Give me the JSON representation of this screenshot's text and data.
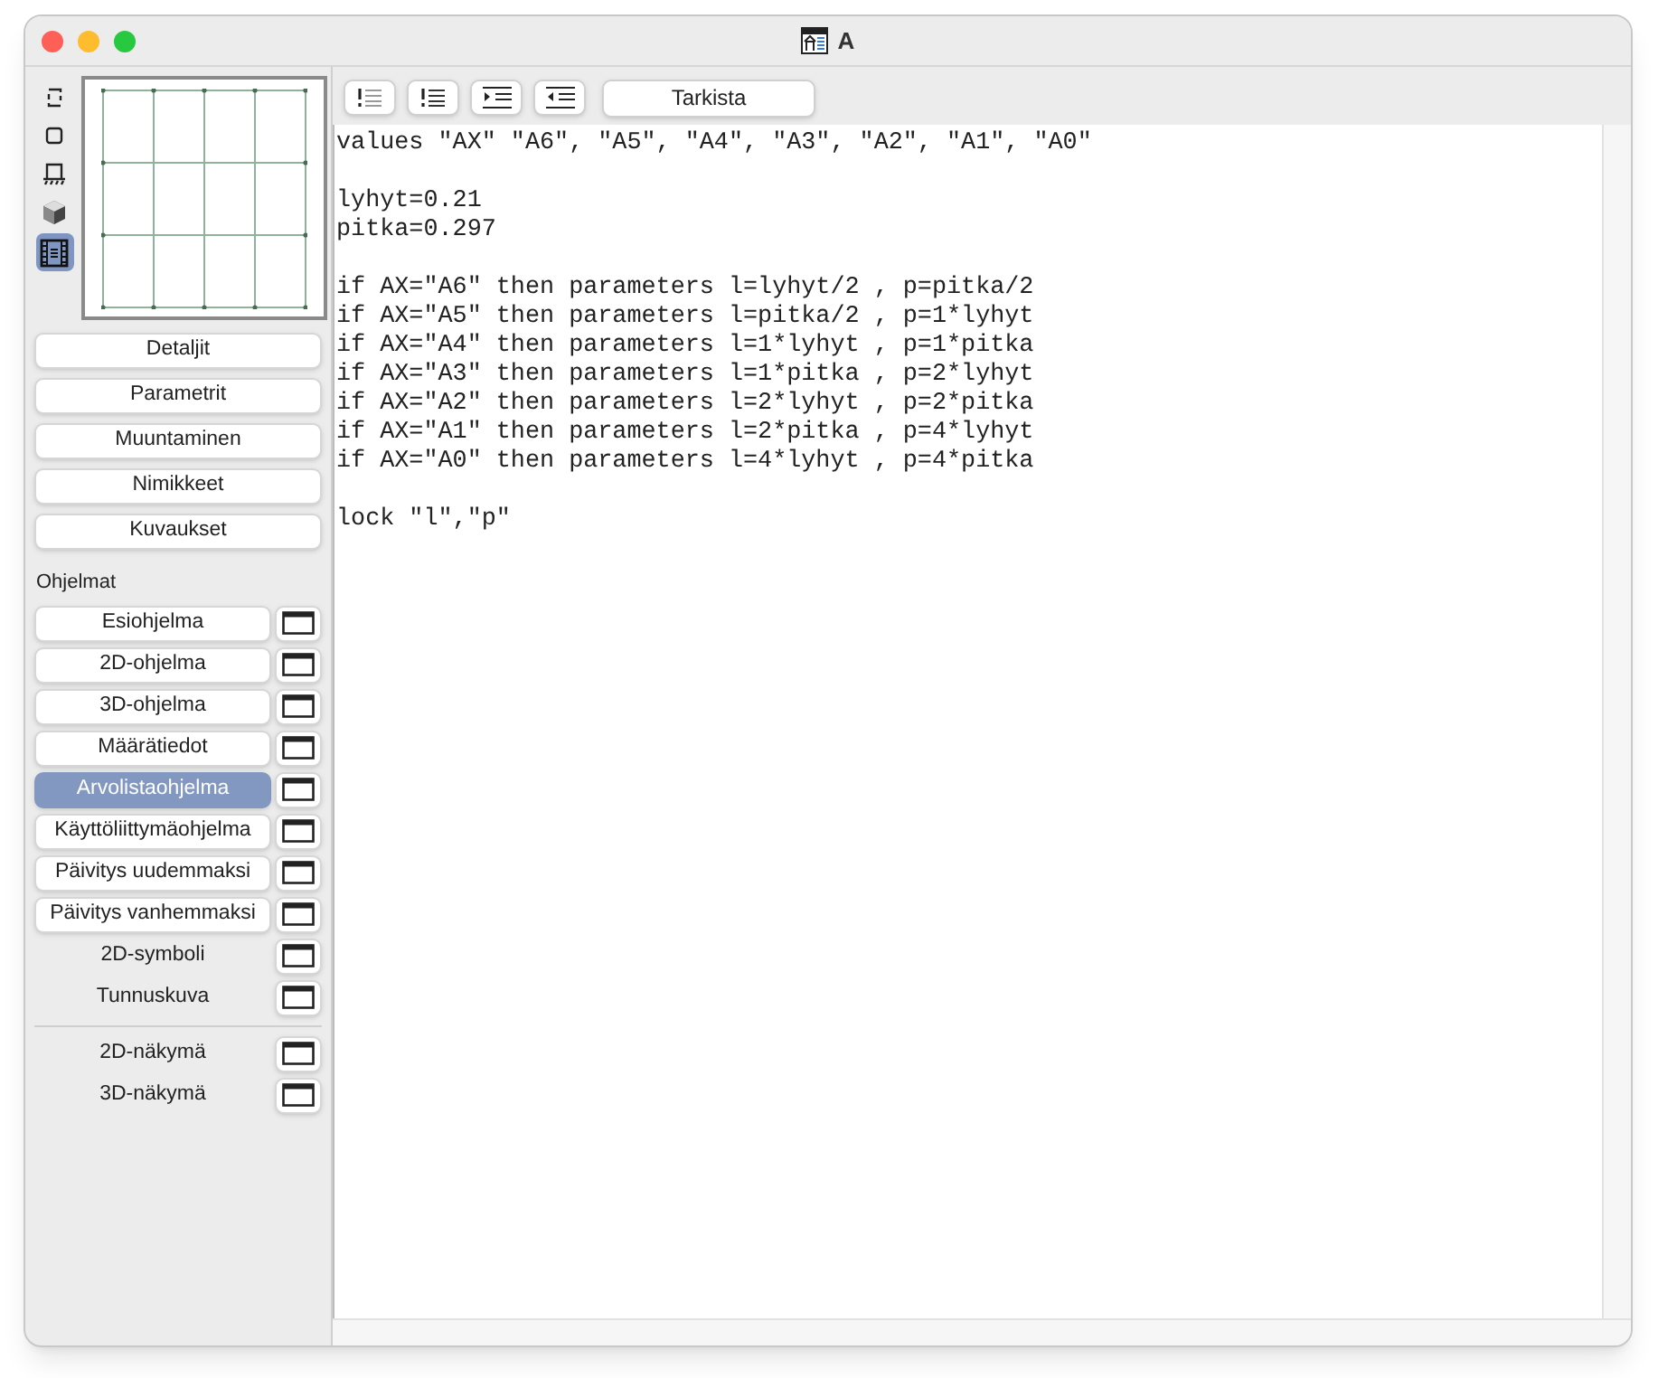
{
  "window": {
    "title": "A"
  },
  "view_icons": [
    {
      "kind": "outline",
      "selected": false
    },
    {
      "kind": "square",
      "selected": false
    },
    {
      "kind": "support",
      "selected": false
    },
    {
      "kind": "cube",
      "selected": false
    },
    {
      "kind": "film",
      "selected": true
    }
  ],
  "sections": [
    "Detaljit",
    "Parametrit",
    "Muuntaminen",
    "Nimikkeet",
    "Kuvaukset"
  ],
  "programs_heading": "Ohjelmat",
  "programs": [
    {
      "label": "Esiohjelma",
      "kind": "button",
      "selected": false
    },
    {
      "label": "2D-ohjelma",
      "kind": "button",
      "selected": false
    },
    {
      "label": "3D-ohjelma",
      "kind": "button",
      "selected": false
    },
    {
      "label": "Määrätiedot",
      "kind": "button",
      "selected": false
    },
    {
      "label": "Arvolistaohjelma",
      "kind": "button",
      "selected": true
    },
    {
      "label": "Käyttöliittymäohjelma",
      "kind": "button",
      "selected": false
    },
    {
      "label": "Päivitys uudemmaksi",
      "kind": "button",
      "selected": false
    },
    {
      "label": "Päivitys vanhemmaksi",
      "kind": "button",
      "selected": false
    },
    {
      "label": "2D-symboli",
      "kind": "plain",
      "selected": false
    },
    {
      "label": "Tunnuskuva",
      "kind": "plain",
      "selected": false
    }
  ],
  "views": [
    {
      "label": "2D-näkymä",
      "selected": false
    },
    {
      "label": "3D-näkymä",
      "selected": false
    }
  ],
  "toolbar": {
    "check_button": "Tarkista"
  },
  "code": "values \"AX\" \"A6\", \"A5\", \"A4\", \"A3\", \"A2\", \"A1\", \"A0\"\n\nlyhyt=0.21\npitka=0.297\n\nif AX=\"A6\" then parameters l=lyhyt/2 , p=pitka/2\nif AX=\"A5\" then parameters l=pitka/2 , p=1*lyhyt\nif AX=\"A4\" then parameters l=1*lyhyt , p=1*pitka\nif AX=\"A3\" then parameters l=1*pitka , p=2*lyhyt\nif AX=\"A2\" then parameters l=2*lyhyt , p=2*pitka\nif AX=\"A1\" then parameters l=2*pitka , p=4*lyhyt\nif AX=\"A0\" then parameters l=4*lyhyt , p=4*pitka\n\nlock \"l\",\"p\""
}
